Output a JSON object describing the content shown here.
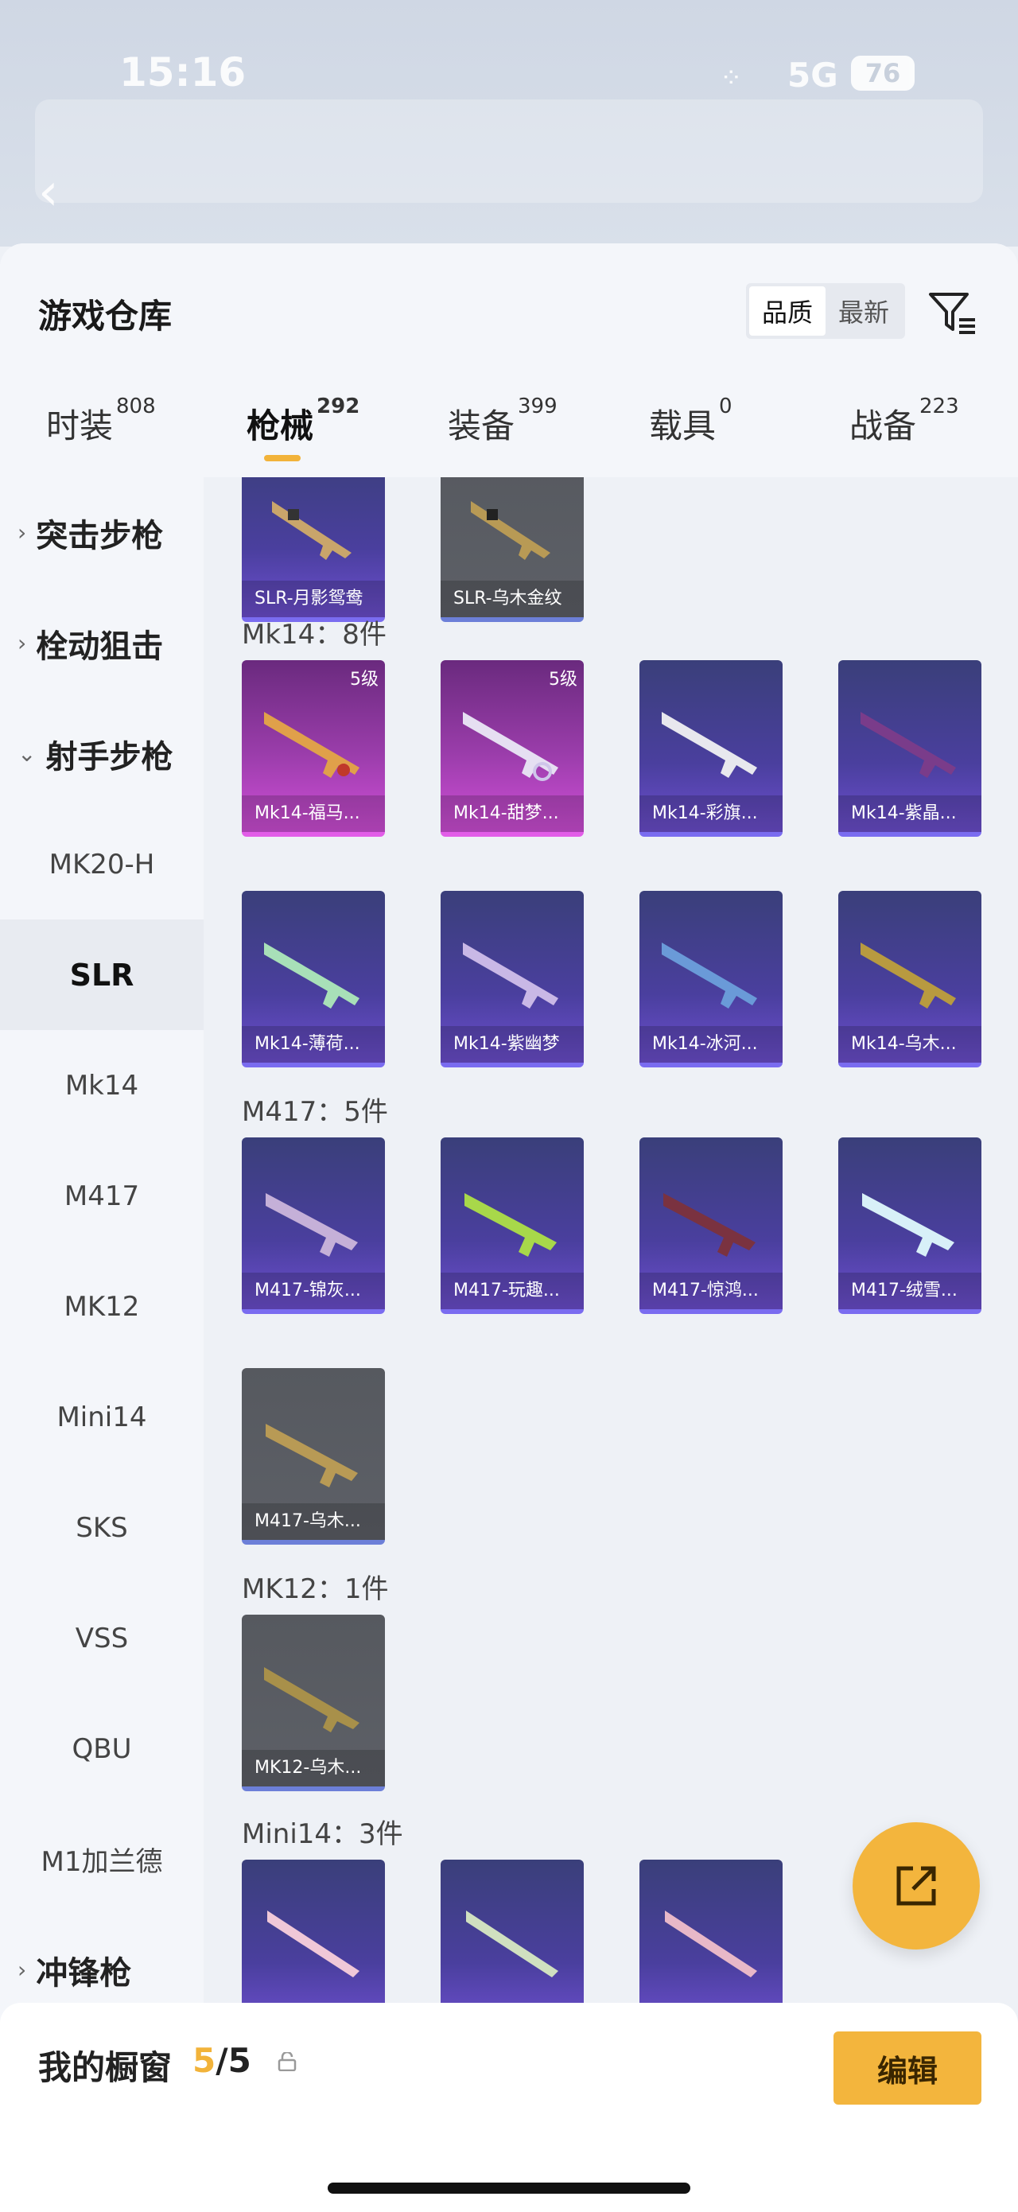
{
  "status_bar": {
    "time": "15:16",
    "network": "5G",
    "battery": "76"
  },
  "header": {
    "title": "游戏仓库",
    "sort_options": [
      "品质",
      "最新"
    ],
    "active_sort": "品质"
  },
  "tabs": [
    {
      "label": "时装",
      "count": "808"
    },
    {
      "label": "枪械",
      "count": "292"
    },
    {
      "label": "装备",
      "count": "399"
    },
    {
      "label": "载具",
      "count": "0"
    },
    {
      "label": "战备",
      "count": "223"
    }
  ],
  "sidebar": [
    {
      "label": "突击步枪",
      "type": "group"
    },
    {
      "label": "栓动狙击",
      "type": "group"
    },
    {
      "label": "射手步枪",
      "type": "group"
    },
    {
      "label": "MK20-H"
    },
    {
      "label": "SLR"
    },
    {
      "label": "Mk14"
    },
    {
      "label": "M417"
    },
    {
      "label": "MK12"
    },
    {
      "label": "Mini14"
    },
    {
      "label": "SKS"
    },
    {
      "label": "VSS"
    },
    {
      "label": "QBU"
    },
    {
      "label": "M1加兰德"
    },
    {
      "label": "冲锋枪",
      "type": "group"
    }
  ],
  "sections": {
    "slr_items": [
      "SLR-月影鸳鸯",
      "SLR-乌木金纹"
    ],
    "mk14_title": "Mk14：8件",
    "mk14_items": [
      "Mk14-福马...",
      "Mk14-甜梦...",
      "Mk14-彩旗...",
      "Mk14-紫晶...",
      "Mk14-薄荷...",
      "Mk14-紫幽梦",
      "Mk14-冰河...",
      "Mk14-乌木..."
    ],
    "level_badge": "5级",
    "m417_title": "M417：5件",
    "m417_items": [
      "M417-锦灰...",
      "M417-玩趣...",
      "M417-惊鸿...",
      "M417-绒雪...",
      "M417-乌木..."
    ],
    "mk12_title": "MK12：1件",
    "mk12_items": [
      "MK12-乌木..."
    ],
    "mini14_title": "Mini14：3件"
  },
  "showcase": {
    "label": "我的橱窗",
    "current": "5",
    "total": "/5",
    "edit_label": "编辑"
  },
  "colors": {
    "accent": "#f3b53d",
    "purple_card": "#4a3f9e",
    "pink_card": "#9b3dab",
    "gray_card": "#5d6067"
  }
}
